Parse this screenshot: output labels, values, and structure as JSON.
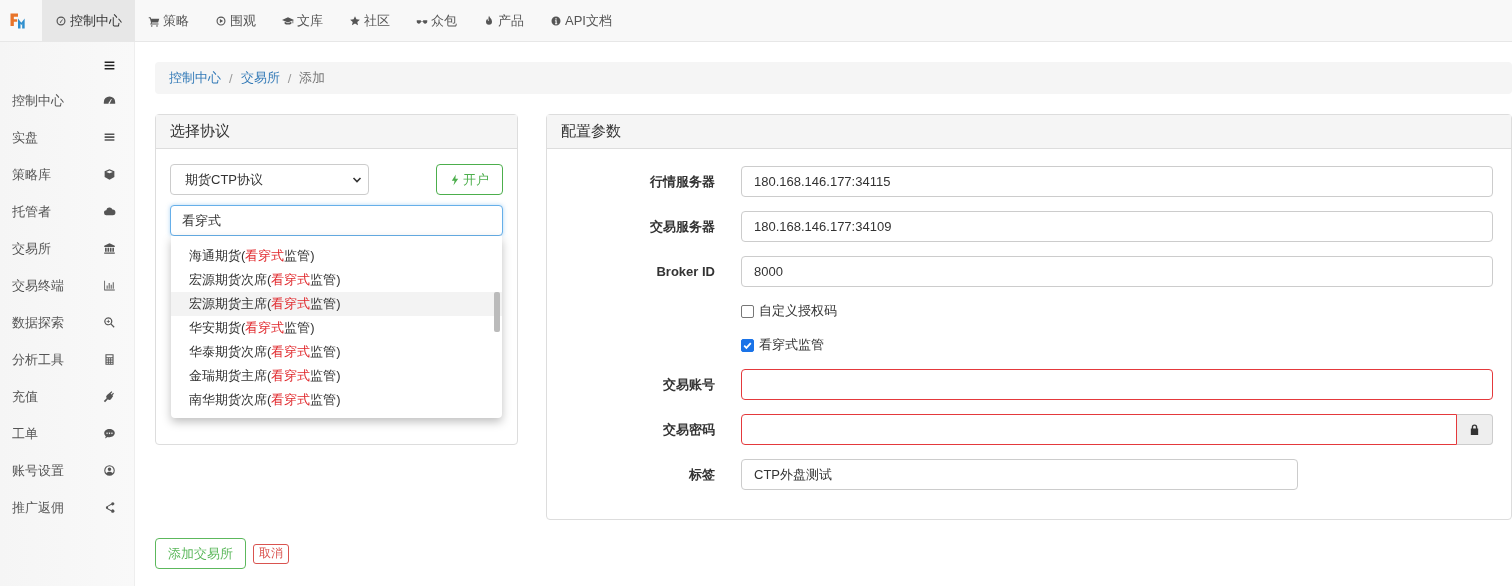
{
  "top_nav": {
    "items": [
      {
        "label": "控制中心",
        "selected": true
      },
      {
        "label": "策略",
        "selected": false
      },
      {
        "label": "围观",
        "selected": false
      },
      {
        "label": "文库",
        "selected": false
      },
      {
        "label": "社区",
        "selected": false
      },
      {
        "label": "众包",
        "selected": false
      },
      {
        "label": "产品",
        "selected": false
      },
      {
        "label": "API文档",
        "selected": false
      }
    ]
  },
  "sidebar": {
    "items": [
      {
        "label": "控制中心"
      },
      {
        "label": "实盘"
      },
      {
        "label": "策略库"
      },
      {
        "label": "托管者"
      },
      {
        "label": "交易所"
      },
      {
        "label": "交易终端"
      },
      {
        "label": "数据探索"
      },
      {
        "label": "分析工具"
      },
      {
        "label": "充值"
      },
      {
        "label": "工单"
      },
      {
        "label": "账号设置"
      },
      {
        "label": "推广返佣"
      }
    ]
  },
  "breadcrumb": [
    {
      "label": "控制中心",
      "link": true
    },
    {
      "separator": "/",
      "label": "交易所",
      "link": true
    },
    {
      "separator": "/",
      "label": "添加",
      "link": false
    }
  ],
  "protocol_panel": {
    "title": "选择协议",
    "select_value": "期货CTP协议",
    "open_button": "开户",
    "search_value": "看穿式",
    "options": [
      {
        "prefix": "海通期货(",
        "match": "看穿式",
        "suffix": "监管)",
        "selected": false
      },
      {
        "prefix": "宏源期货次席(",
        "match": "看穿式",
        "suffix": "监管)",
        "selected": false
      },
      {
        "prefix": "宏源期货主席(",
        "match": "看穿式",
        "suffix": "监管)",
        "selected": true
      },
      {
        "prefix": "华安期货(",
        "match": "看穿式",
        "suffix": "监管)",
        "selected": false
      },
      {
        "prefix": "华泰期货次席(",
        "match": "看穿式",
        "suffix": "监管)",
        "selected": false
      },
      {
        "prefix": "金瑞期货主席(",
        "match": "看穿式",
        "suffix": "监管)",
        "selected": false
      },
      {
        "prefix": "南华期货次席(",
        "match": "看穿式",
        "suffix": "监管)",
        "selected": false
      }
    ]
  },
  "config_panel": {
    "title": "配置参数",
    "fields": [
      {
        "kind": "text",
        "label": "行情服务器",
        "value": "180.168.146.177:34115",
        "invalid": false
      },
      {
        "kind": "text",
        "label": "交易服务器",
        "value": "180.168.146.177:34109",
        "invalid": false
      },
      {
        "kind": "text",
        "label": "Broker ID",
        "value": "8000",
        "invalid": false
      },
      {
        "kind": "checkbox",
        "label": "自定义授权码",
        "checked": false
      },
      {
        "kind": "checkbox",
        "label": "看穿式监管",
        "checked": true
      },
      {
        "kind": "text",
        "label": "交易账号",
        "invalid": true
      },
      {
        "kind": "password",
        "label": "交易密码",
        "invalid": true
      },
      {
        "kind": "short",
        "label": "标签",
        "value": "CTP外盘测试",
        "invalid": false
      }
    ]
  },
  "buttons": {
    "submit": "添加交易所",
    "cancel": "取消"
  }
}
